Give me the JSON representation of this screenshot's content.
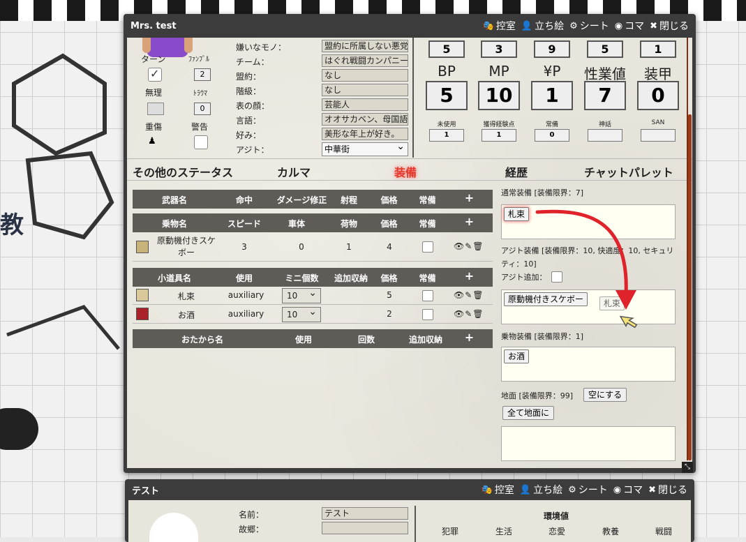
{
  "window1": {
    "title": "Mrs. test",
    "buttons": [
      "控室",
      "立ち絵",
      "シート",
      "コマ",
      "閉じる"
    ],
    "left_status": {
      "turn_label": "ターン",
      "fumble_label": "ﾌｧﾝﾌﾞﾙ",
      "fumble_value": "2",
      "invalid_label": "無理",
      "trauma_label": "ﾄﾗｳﾏ",
      "trauma_value": "0",
      "heavy_label": "重傷",
      "warning_label": "警告"
    },
    "profile": [
      {
        "label": "嫌いなモノ：",
        "value": "盟約に所属しない悪党"
      },
      {
        "label": "チーム：",
        "value": "はぐれ戦闘カンパニー"
      },
      {
        "label": "盟約：",
        "value": "なし"
      },
      {
        "label": "階級：",
        "value": "なし"
      },
      {
        "label": "表の顔：",
        "value": "芸能人"
      },
      {
        "label": "言語：",
        "value": "オオサカベン、母国語"
      },
      {
        "label": "好み：",
        "value": "美形な年上が好き。"
      }
    ],
    "agito_label": "アジト：",
    "agito_value": "中華街",
    "small_stats": [
      "5",
      "3",
      "9",
      "5",
      "1"
    ],
    "big_stats": [
      {
        "label": "BP",
        "value": "5"
      },
      {
        "label": "MP",
        "value": "10"
      },
      {
        "label": "¥P",
        "value": "1"
      },
      {
        "label": "性業値",
        "value": "7"
      },
      {
        "label": "装甲",
        "value": "0"
      }
    ],
    "mini_stats": [
      {
        "label": "未使用",
        "value": "1"
      },
      {
        "label": "獲得経験点",
        "value": "1"
      },
      {
        "label": "常備",
        "value": "0"
      },
      {
        "label": "神話",
        "value": ""
      },
      {
        "label": "SAN",
        "value": ""
      }
    ],
    "tabs": [
      "その他のステータス",
      "カルマ",
      "装備",
      "経歴",
      "チャットパレット"
    ],
    "weapons_header": [
      "武器名",
      "命中",
      "ダメージ修正",
      "射程",
      "価格",
      "常備",
      "+"
    ],
    "vehicle_header": [
      "乗物名",
      "スピード",
      "車体",
      "荷物",
      "価格",
      "常備",
      "+"
    ],
    "vehicle_rows": [
      {
        "name": "原動機付きスケボー",
        "speed": "3",
        "body": "0",
        "cargo": "1",
        "price": "4"
      }
    ],
    "items_header": [
      "小道具名",
      "使用",
      "ミニ個数",
      "追加収納",
      "価格",
      "常備",
      "+"
    ],
    "item_rows": [
      {
        "name": "札束",
        "use": "auxiliary",
        "qty": "10",
        "price": "5"
      },
      {
        "name": "お酒",
        "use": "auxiliary",
        "qty": "10",
        "price": "2"
      }
    ],
    "treasure_header": [
      "おたから名",
      "使用",
      "回数",
      "追加収納",
      "+"
    ],
    "equip": {
      "normal_label": "通常装備 [装備限界：7]",
      "normal_items": [
        "札束"
      ],
      "agito_label": "アジト装備 [装備限界：10, 快適度：10, セキュリティ：10]",
      "agito_add": "アジト追加：",
      "agito_items": [
        "原動機付きスケボー"
      ],
      "drag_ghost": "札束",
      "vehicle_label": "乗物装備 [装備限界：1]",
      "vehicle_items": [
        "お酒"
      ],
      "ground_label": "地面 [装備限界：99]",
      "empty_button": "空にする",
      "all_ground_button": "全て地面に"
    }
  },
  "window2": {
    "title": "テスト",
    "buttons": [
      "控室",
      "立ち絵",
      "シート",
      "コマ",
      "閉じる"
    ],
    "name_label": "名前：",
    "name_value": "テスト",
    "home_label": "故郷：",
    "env_label": "環境値",
    "env_cols": [
      "犯罪",
      "生活",
      "恋愛",
      "教養",
      "戦闘"
    ]
  },
  "colors": {
    "accent_red": "#e23b2e",
    "title_bg": "#3c3c3c",
    "table_head": "#5f5c58"
  }
}
